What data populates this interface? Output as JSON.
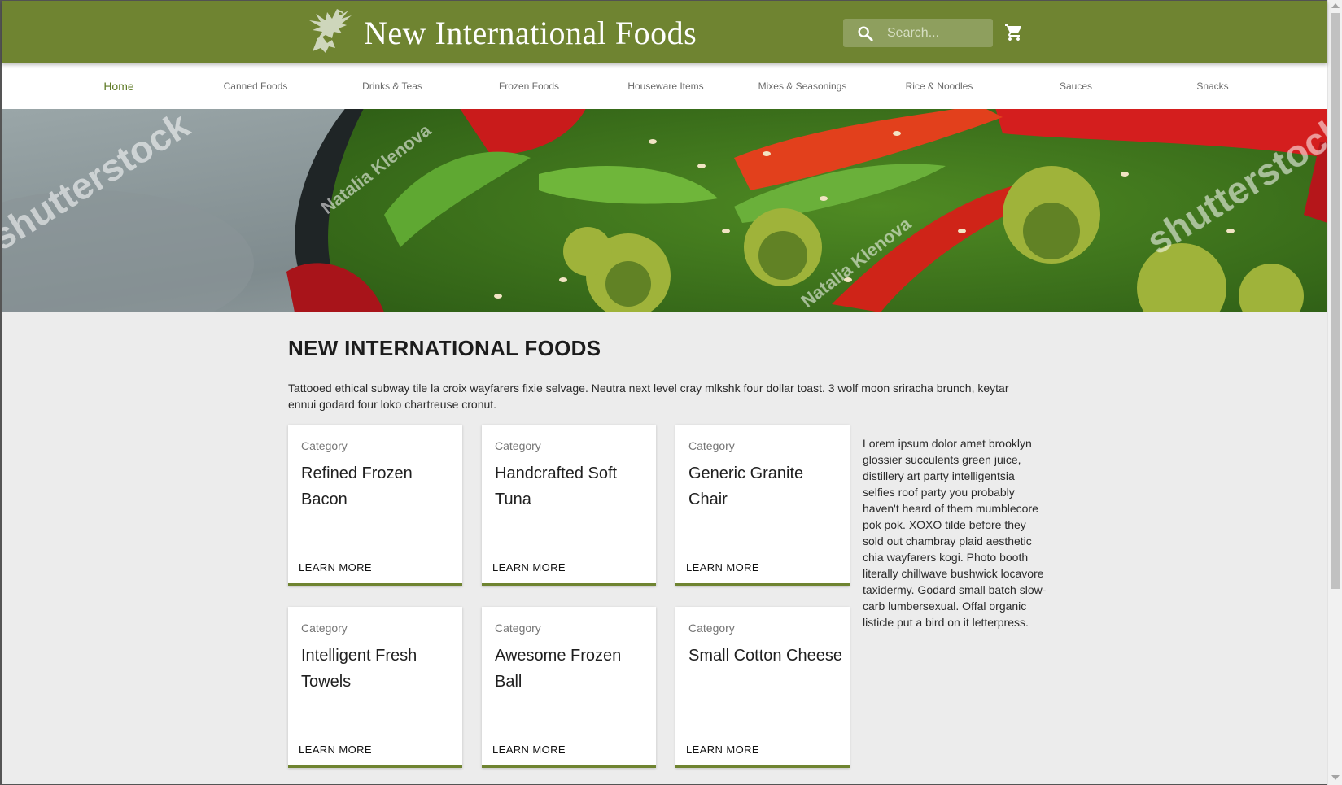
{
  "header": {
    "brand": "New International Foods",
    "logo_icon": "eagle-logo-icon",
    "search_placeholder": "Search...",
    "search_icon": "search-icon",
    "cart_icon": "cart-icon",
    "background_color": "#6f8431"
  },
  "nav": {
    "items": [
      {
        "label": "Home",
        "active": true
      },
      {
        "label": "Canned Foods"
      },
      {
        "label": "Drinks & Teas"
      },
      {
        "label": "Frozen Foods"
      },
      {
        "label": "Houseware Items"
      },
      {
        "label": "Mixes & Seasonings"
      },
      {
        "label": "Rice & Noodles"
      },
      {
        "label": "Sauces"
      },
      {
        "label": "Snacks"
      }
    ],
    "active_color": "#5e7a25"
  },
  "hero": {
    "watermarks": [
      "shutterstock",
      "Natalia Klenova",
      "Natalia Klenova",
      "shutterstock"
    ]
  },
  "main": {
    "title": "NEW INTERNATIONAL FOODS",
    "intro": "Tattooed ethical subway tile la croix wayfarers fixie selvage. Neutra next level cray mlkshk four dollar toast. 3 wolf moon sriracha brunch, keytar ennui godard four loko chartreuse cronut.",
    "cards": [
      {
        "category": "Category",
        "title": "Refined Frozen Bacon",
        "button": "LEARN MORE"
      },
      {
        "category": "Category",
        "title": "Handcrafted Soft Tuna",
        "button": "LEARN MORE"
      },
      {
        "category": "Category",
        "title": "Generic Granite Chair",
        "button": "LEARN MORE"
      },
      {
        "category": "Category",
        "title": "Intelligent Fresh Towels",
        "button": "LEARN MORE"
      },
      {
        "category": "Category",
        "title": "Awesome Frozen Ball",
        "button": "LEARN MORE"
      },
      {
        "category": "Category",
        "title": "Small Cotton Cheese",
        "button": "LEARN MORE"
      }
    ],
    "side_text": "Lorem ipsum dolor amet brooklyn glossier succulents green juice, distillery art party intelligentsia selfies roof party you probably haven't heard of them mumblecore pok pok. XOXO tilde before they sold out chambray plaid aesthetic chia wayfarers kogi. Photo booth literally chillwave bushwick locavore taxidermy. Godard small batch slow-carb lumbersexual. Offal organic listicle put a bird on it letterpress.",
    "card_accent_color": "#6f8431"
  }
}
